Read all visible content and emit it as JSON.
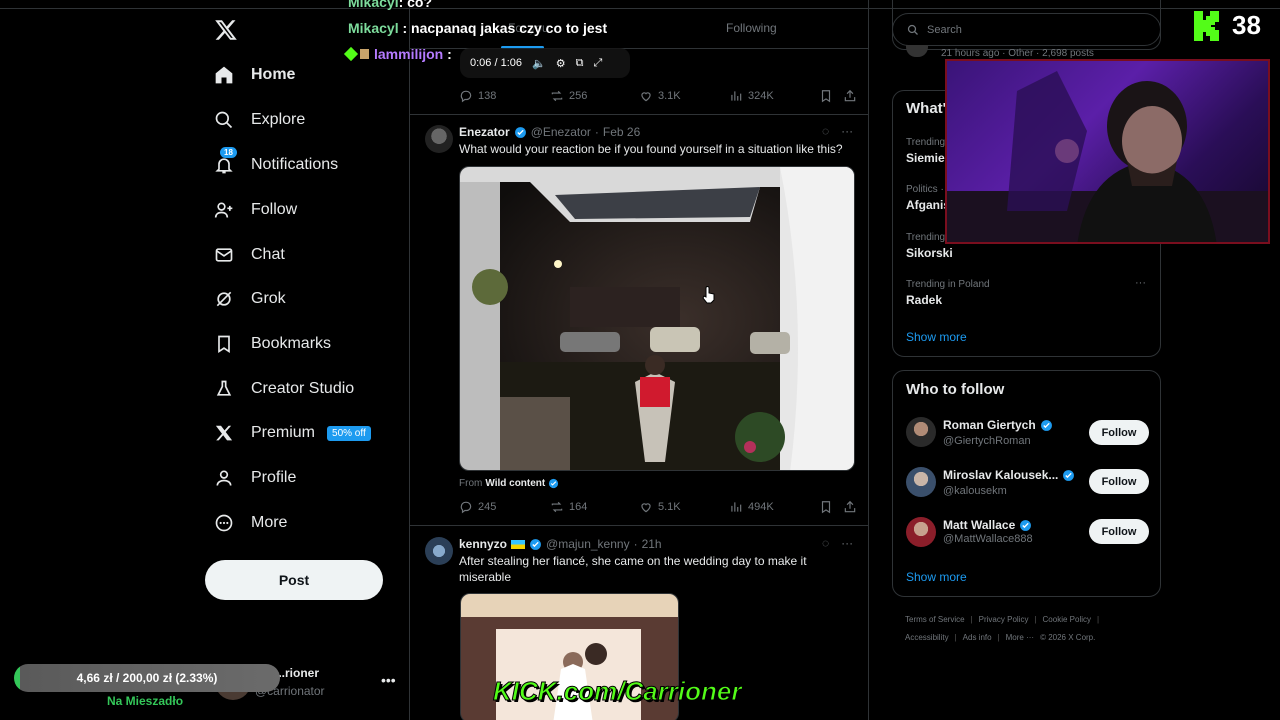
{
  "overlay": {
    "chat": [
      {
        "user": "Mikacyl",
        "message": ": co?"
      },
      {
        "user": "Mikacyl",
        "message": ": nacpanaq jakas czy co to jest"
      },
      {
        "user": "lammilijon",
        "message": ":"
      }
    ],
    "viewer_count": "38",
    "donation_progress": "4,66 zł / 200,00 zł (2.33%)",
    "donation_fraction": 0.0233,
    "donation_label": "Na Mieszadło",
    "kick_url": "KICK.com/Carrioner"
  },
  "nav": {
    "items": [
      {
        "label": "Home",
        "icon": "home-icon"
      },
      {
        "label": "Explore",
        "icon": "search-icon"
      },
      {
        "label": "Notifications",
        "icon": "bell-icon",
        "badge": "18"
      },
      {
        "label": "Follow",
        "icon": "add-person-icon"
      },
      {
        "label": "Chat",
        "icon": "mail-icon"
      },
      {
        "label": "Grok",
        "icon": "grok-icon"
      },
      {
        "label": "Bookmarks",
        "icon": "bookmark-icon"
      },
      {
        "label": "Creator Studio",
        "icon": "flask-icon"
      },
      {
        "label": "Premium",
        "icon": "x-icon",
        "promo": "50% off"
      },
      {
        "label": "Profile",
        "icon": "person-icon"
      },
      {
        "label": "More",
        "icon": "more-circle-icon"
      }
    ],
    "post_label": "Post",
    "account": {
      "name": "...rioner",
      "handle": "@carrionator"
    }
  },
  "timeline": {
    "tabs": [
      "For you",
      "Following"
    ],
    "video_time": "0:06 / 1:06",
    "prev_tweet_stats": {
      "replies": "138",
      "reposts": "256",
      "likes": "3.1K",
      "views": "324K"
    },
    "tweets": [
      {
        "name": "Enezator",
        "handle": "@Enezator",
        "time": "Feb 26",
        "text": "What would your reaction be if you found yourself in a situation like this?",
        "from_prefix": "From",
        "from_source": "Wild content",
        "stats": {
          "replies": "245",
          "reposts": "164",
          "likes": "5.1K",
          "views": "494K"
        }
      },
      {
        "name": "kennyzo",
        "handle": "@majun_kenny",
        "time": "21h",
        "text": "After stealing her fiancé,  she came on the wedding day to make it miserable"
      }
    ]
  },
  "sidebar": {
    "search_placeholder": "Search",
    "trends_snippet": "21 hours ago · Other · 2,698 posts",
    "trends_title": "What's happening",
    "trends": [
      {
        "category": "Trending",
        "name": "Siemie"
      },
      {
        "category": "Politics ·",
        "name": "Afganis"
      },
      {
        "category": "Trending",
        "name": "Sikorski"
      },
      {
        "category": "Trending in Poland",
        "name": "Radek"
      }
    ],
    "show_more": "Show more",
    "who_to_follow_title": "Who to follow",
    "who_to_follow": [
      {
        "name": "Roman Giertych",
        "handle": "@GiertychRoman",
        "button": "Follow"
      },
      {
        "name": "Miroslav Kalousek...",
        "handle": "@kalousekm",
        "button": "Follow"
      },
      {
        "name": "Matt Wallace",
        "handle": "@MattWallace888",
        "button": "Follow"
      }
    ],
    "footer_links": [
      "Terms of Service",
      "Privacy Policy",
      "Cookie Policy",
      "Accessibility",
      "Ads info",
      "More ···",
      "© 2026 X Corp."
    ]
  },
  "colors": {
    "accent": "#1d9bf0",
    "kick_green": "#53fc18",
    "background": "#000000"
  }
}
